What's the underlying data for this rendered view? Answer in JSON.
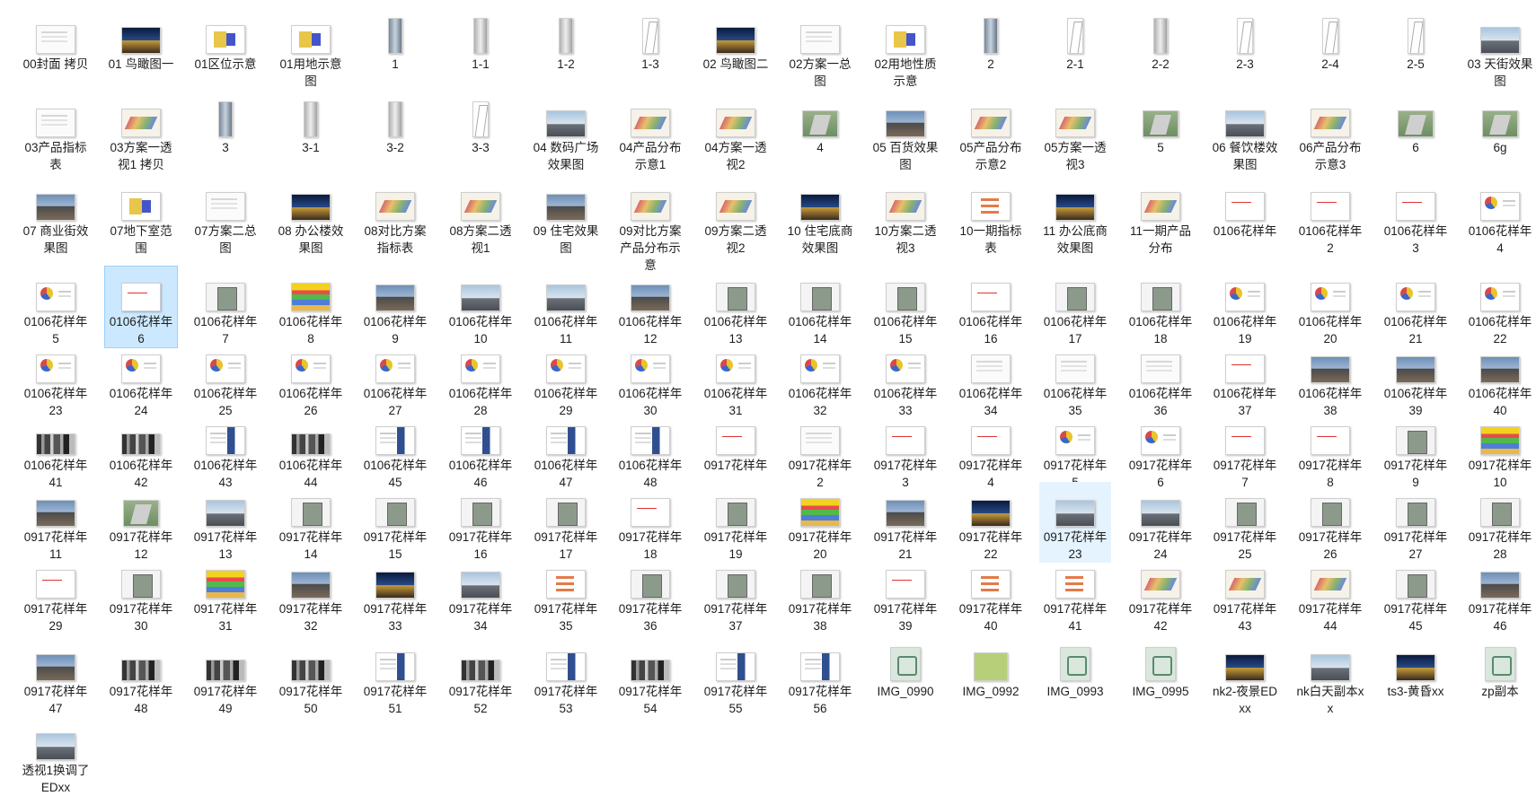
{
  "window": {
    "view": "large-icons"
  },
  "files": [
    {
      "label": "00封面 拷贝",
      "thumb": "doc"
    },
    {
      "label": "01 鸟瞰图一",
      "thumb": "night"
    },
    {
      "label": "01区位示意",
      "thumb": "plan"
    },
    {
      "label": "01用地示意图",
      "thumb": "plan"
    },
    {
      "label": "1",
      "thumb": "tower"
    },
    {
      "label": "1-1",
      "thumb": "towerG"
    },
    {
      "label": "1-2",
      "thumb": "towerG"
    },
    {
      "label": "1-3",
      "thumb": "sketch"
    },
    {
      "label": "02 鸟瞰图二",
      "thumb": "night"
    },
    {
      "label": "02方案一总图",
      "thumb": "doc"
    },
    {
      "label": "02用地性质示意",
      "thumb": "plan"
    },
    {
      "label": "2",
      "thumb": "tower"
    },
    {
      "label": "2-1",
      "thumb": "sketch"
    },
    {
      "label": "2-2",
      "thumb": "towerG"
    },
    {
      "label": "2-3",
      "thumb": "sketch"
    },
    {
      "label": "2-4",
      "thumb": "sketch"
    },
    {
      "label": "2-5",
      "thumb": "sketch"
    },
    {
      "label": "03 天街效果图",
      "thumb": "city"
    },
    {
      "label": "03产品指标表",
      "thumb": "doc"
    },
    {
      "label": "03方案一透视1 拷贝",
      "thumb": "axon"
    },
    {
      "label": "3",
      "thumb": "tower"
    },
    {
      "label": "3-1",
      "thumb": "towerG"
    },
    {
      "label": "3-2",
      "thumb": "towerG"
    },
    {
      "label": "3-3",
      "thumb": "sketch"
    },
    {
      "label": "04 数码广场效果图",
      "thumb": "city"
    },
    {
      "label": "04产品分布示意1",
      "thumb": "axon"
    },
    {
      "label": "04方案一透视2",
      "thumb": "axon"
    },
    {
      "label": "4",
      "thumb": "green"
    },
    {
      "label": "05 百货效果图",
      "thumb": "photo"
    },
    {
      "label": "05产品分布示意2",
      "thumb": "axon"
    },
    {
      "label": "05方案一透视3",
      "thumb": "axon"
    },
    {
      "label": "5",
      "thumb": "green"
    },
    {
      "label": "06 餐饮楼效果图",
      "thumb": "city"
    },
    {
      "label": "06产品分布示意3",
      "thumb": "axon"
    },
    {
      "label": "6",
      "thumb": "green"
    },
    {
      "label": "6g",
      "thumb": "green"
    },
    {
      "label": "07 商业街效果图",
      "thumb": "photo"
    },
    {
      "label": "07地下室范围",
      "thumb": "plan"
    },
    {
      "label": "07方案二总图",
      "thumb": "doc"
    },
    {
      "label": "08 办公楼效果图",
      "thumb": "night"
    },
    {
      "label": "08对比方案指标表",
      "thumb": "axon"
    },
    {
      "label": "08方案二透视1",
      "thumb": "axon"
    },
    {
      "label": "09 住宅效果图",
      "thumb": "photo"
    },
    {
      "label": "09对比方案产品分布示意",
      "thumb": "axon"
    },
    {
      "label": "09方案二透视2",
      "thumb": "axon"
    },
    {
      "label": "10 住宅底商效果图",
      "thumb": "night"
    },
    {
      "label": "10方案二透视3",
      "thumb": "axon"
    },
    {
      "label": "10一期指标表",
      "thumb": "redtxt"
    },
    {
      "label": "11 办公底商效果图",
      "thumb": "night"
    },
    {
      "label": "11一期产品分布",
      "thumb": "axon"
    },
    {
      "label": "0106花样年",
      "thumb": "docR"
    },
    {
      "label": "0106花样年2",
      "thumb": "docR"
    },
    {
      "label": "0106花样年3",
      "thumb": "docR"
    },
    {
      "label": "0106花样年4",
      "thumb": "pie"
    },
    {
      "label": "0106花样年5",
      "thumb": "pie"
    },
    {
      "label": "0106花样年6",
      "thumb": "docR",
      "selected": true
    },
    {
      "label": "0106花样年7",
      "thumb": "mapG"
    },
    {
      "label": "0106花样年8",
      "thumb": "colorbars"
    },
    {
      "label": "0106花样年9",
      "thumb": "photo"
    },
    {
      "label": "0106花样年10",
      "thumb": "city"
    },
    {
      "label": "0106花样年11",
      "thumb": "city"
    },
    {
      "label": "0106花样年12",
      "thumb": "photo"
    },
    {
      "label": "0106花样年13",
      "thumb": "mapG"
    },
    {
      "label": "0106花样年14",
      "thumb": "mapG"
    },
    {
      "label": "0106花样年15",
      "thumb": "mapG"
    },
    {
      "label": "0106花样年16",
      "thumb": "docR"
    },
    {
      "label": "0106花样年17",
      "thumb": "mapG"
    },
    {
      "label": "0106花样年18",
      "thumb": "mapG"
    },
    {
      "label": "0106花样年19",
      "thumb": "pie"
    },
    {
      "label": "0106花样年20",
      "thumb": "pie"
    },
    {
      "label": "0106花样年21",
      "thumb": "pie"
    },
    {
      "label": "0106花样年22",
      "thumb": "pie"
    },
    {
      "label": "0106花样年23",
      "thumb": "pie"
    },
    {
      "label": "0106花样年24",
      "thumb": "pie"
    },
    {
      "label": "0106花样年25",
      "thumb": "pie"
    },
    {
      "label": "0106花样年26",
      "thumb": "pie"
    },
    {
      "label": "0106花样年27",
      "thumb": "pie"
    },
    {
      "label": "0106花样年28",
      "thumb": "pie"
    },
    {
      "label": "0106花样年29",
      "thumb": "pie"
    },
    {
      "label": "0106花样年30",
      "thumb": "pie"
    },
    {
      "label": "0106花样年31",
      "thumb": "pie"
    },
    {
      "label": "0106花样年32",
      "thumb": "pie"
    },
    {
      "label": "0106花样年33",
      "thumb": "pie"
    },
    {
      "label": "0106花样年34",
      "thumb": "doc"
    },
    {
      "label": "0106花样年35",
      "thumb": "doc"
    },
    {
      "label": "0106花样年36",
      "thumb": "doc"
    },
    {
      "label": "0106花样年37",
      "thumb": "docR"
    },
    {
      "label": "0106花样年38",
      "thumb": "photo"
    },
    {
      "label": "0106花样年39",
      "thumb": "photo"
    },
    {
      "label": "0106花样年40",
      "thumb": "photo"
    },
    {
      "label": "0106花样年41",
      "thumb": "strip"
    },
    {
      "label": "0106花样年42",
      "thumb": "strip"
    },
    {
      "label": "0106花样年43",
      "thumb": "mix"
    },
    {
      "label": "0106花样年44",
      "thumb": "strip"
    },
    {
      "label": "0106花样年45",
      "thumb": "mix"
    },
    {
      "label": "0106花样年46",
      "thumb": "mix"
    },
    {
      "label": "0106花样年47",
      "thumb": "mix"
    },
    {
      "label": "0106花样年48",
      "thumb": "mix"
    },
    {
      "label": "0917花样年",
      "thumb": "docR"
    },
    {
      "label": "0917花样年2",
      "thumb": "doc"
    },
    {
      "label": "0917花样年3",
      "thumb": "docR"
    },
    {
      "label": "0917花样年4",
      "thumb": "docR"
    },
    {
      "label": "0917花样年5",
      "thumb": "pie"
    },
    {
      "label": "0917花样年6",
      "thumb": "pie"
    },
    {
      "label": "0917花样年7",
      "thumb": "docR"
    },
    {
      "label": "0917花样年8",
      "thumb": "docR"
    },
    {
      "label": "0917花样年9",
      "thumb": "mapG"
    },
    {
      "label": "0917花样年10",
      "thumb": "colorbars"
    },
    {
      "label": "0917花样年11",
      "thumb": "photo"
    },
    {
      "label": "0917花样年12",
      "thumb": "green"
    },
    {
      "label": "0917花样年13",
      "thumb": "city"
    },
    {
      "label": "0917花样年14",
      "thumb": "mapG"
    },
    {
      "label": "0917花样年15",
      "thumb": "mapG"
    },
    {
      "label": "0917花样年16",
      "thumb": "mapG"
    },
    {
      "label": "0917花样年17",
      "thumb": "mapG"
    },
    {
      "label": "0917花样年18",
      "thumb": "docR"
    },
    {
      "label": "0917花样年19",
      "thumb": "mapG"
    },
    {
      "label": "0917花样年20",
      "thumb": "colorbars"
    },
    {
      "label": "0917花样年21",
      "thumb": "photo"
    },
    {
      "label": "0917花样年22",
      "thumb": "night"
    },
    {
      "label": "0917花样年23",
      "thumb": "city",
      "hover": true
    },
    {
      "label": "0917花样年24",
      "thumb": "city"
    },
    {
      "label": "0917花样年25",
      "thumb": "mapG"
    },
    {
      "label": "0917花样年26",
      "thumb": "mapG"
    },
    {
      "label": "0917花样年27",
      "thumb": "mapG"
    },
    {
      "label": "0917花样年28",
      "thumb": "mapG"
    },
    {
      "label": "0917花样年29",
      "thumb": "docR"
    },
    {
      "label": "0917花样年30",
      "thumb": "mapG"
    },
    {
      "label": "0917花样年31",
      "thumb": "colorbars"
    },
    {
      "label": "0917花样年32",
      "thumb": "photo"
    },
    {
      "label": "0917花样年33",
      "thumb": "night"
    },
    {
      "label": "0917花样年34",
      "thumb": "city"
    },
    {
      "label": "0917花样年35",
      "thumb": "redtxt"
    },
    {
      "label": "0917花样年36",
      "thumb": "mapG"
    },
    {
      "label": "0917花样年37",
      "thumb": "mapG"
    },
    {
      "label": "0917花样年38",
      "thumb": "mapG"
    },
    {
      "label": "0917花样年39",
      "thumb": "docR"
    },
    {
      "label": "0917花样年40",
      "thumb": "redtxt"
    },
    {
      "label": "0917花样年41",
      "thumb": "redtxt"
    },
    {
      "label": "0917花样年42",
      "thumb": "axon"
    },
    {
      "label": "0917花样年43",
      "thumb": "axon"
    },
    {
      "label": "0917花样年44",
      "thumb": "axon"
    },
    {
      "label": "0917花样年45",
      "thumb": "mapG"
    },
    {
      "label": "0917花样年46",
      "thumb": "photo"
    },
    {
      "label": "0917花样年47",
      "thumb": "photo"
    },
    {
      "label": "0917花样年48",
      "thumb": "strip"
    },
    {
      "label": "0917花样年49",
      "thumb": "strip"
    },
    {
      "label": "0917花样年50",
      "thumb": "strip"
    },
    {
      "label": "0917花样年51",
      "thumb": "mix"
    },
    {
      "label": "0917花样年52",
      "thumb": "strip"
    },
    {
      "label": "0917花样年53",
      "thumb": "mix"
    },
    {
      "label": "0917花样年54",
      "thumb": "strip"
    },
    {
      "label": "0917花样年55",
      "thumb": "mix"
    },
    {
      "label": "0917花样年56",
      "thumb": "mix"
    },
    {
      "label": "IMG_0990",
      "thumb": "seal"
    },
    {
      "label": "IMG_0992",
      "thumb": "sealY"
    },
    {
      "label": "IMG_0993",
      "thumb": "seal"
    },
    {
      "label": "IMG_0995",
      "thumb": "seal"
    },
    {
      "label": "nk2-夜景EDxx",
      "thumb": "night"
    },
    {
      "label": "nk白天副本xx",
      "thumb": "city"
    },
    {
      "label": "ts3-黄昏xx",
      "thumb": "night"
    },
    {
      "label": "zp副本",
      "thumb": "seal"
    },
    {
      "label": "透视1换调了EDxx",
      "thumb": "city"
    }
  ]
}
